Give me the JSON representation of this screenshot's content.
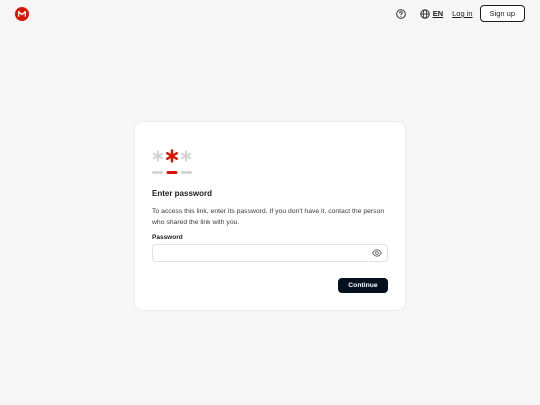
{
  "header": {
    "logo_icon": "mega-logo-icon",
    "help_icon": "help-circle-icon",
    "globe_icon": "globe-icon",
    "language": "EN",
    "login_label": "Log in",
    "signup_label": "Sign up"
  },
  "card": {
    "illustration_icon": "password-asterisks-illustration",
    "title": "Enter password",
    "description": "To access this link, enter its password. If you don't have it, contact the person who shared the link with you.",
    "password_label": "Password",
    "password_value": "",
    "password_placeholder": "",
    "show_password_icon": "eye-icon",
    "continue_label": "Continue"
  },
  "colors": {
    "brand_red": "#dd1405",
    "button_dark": "#04101e",
    "background": "#f6f6f6",
    "card": "#ffffff",
    "asterisk_gray": "#d5d5d5"
  }
}
